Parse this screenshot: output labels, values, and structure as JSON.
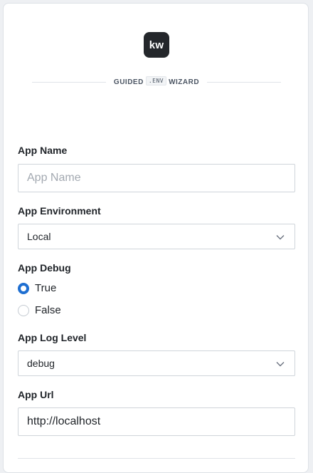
{
  "logo": {
    "text": "kw"
  },
  "header": {
    "left": "GUIDED",
    "badge": ".ENV",
    "right": "WIZARD"
  },
  "fields": {
    "app_name": {
      "label": "App Name",
      "placeholder": "App Name",
      "value": ""
    },
    "app_environment": {
      "label": "App Environment",
      "value": "Local"
    },
    "app_debug": {
      "label": "App Debug",
      "options": [
        "True",
        "False"
      ],
      "selected": "True"
    },
    "app_log_level": {
      "label": "App Log Level",
      "value": "debug"
    },
    "app_url": {
      "label": "App Url",
      "value": "http://localhost"
    }
  },
  "colors": {
    "accent": "#1f6fd1",
    "logo_bg": "#24272b"
  }
}
